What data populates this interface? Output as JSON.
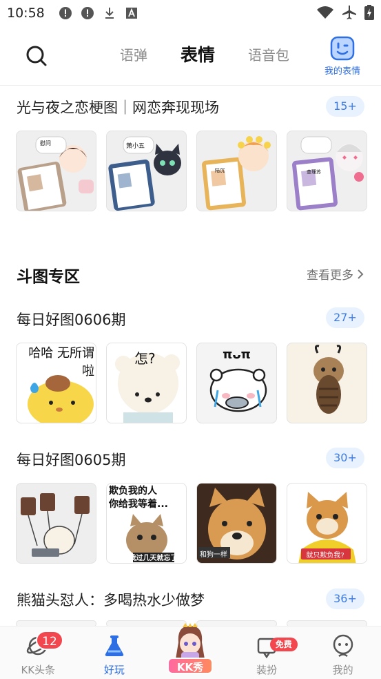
{
  "status_bar": {
    "time": "10:58",
    "left_icons": [
      "alert-circle-icon",
      "alert-circle-icon",
      "download-icon",
      "font-icon"
    ],
    "right_icons": [
      "wifi-icon",
      "airplane-icon",
      "battery-charging-icon"
    ]
  },
  "top_nav": {
    "tabs": [
      {
        "label": "语弹"
      },
      {
        "label": "表情"
      },
      {
        "label": "语音包"
      }
    ],
    "active_tab": "表情",
    "my_emoji_label": "我的表情"
  },
  "featured": {
    "title": "光与夜之恋梗图｜网恋奔现现场",
    "count": "15+",
    "thumbs": [
      {
        "caption": "慰问"
      },
      {
        "caption": "萧小五"
      },
      {
        "caption": "陆沉"
      },
      {
        "caption": "查理苏"
      }
    ]
  },
  "section": {
    "heading": "斗图专区",
    "see_more": "查看更多"
  },
  "rows": [
    {
      "title": "每日好图0606期",
      "count": "27+",
      "thumbs": [
        {
          "caption": "哈哈 无所谓\n啦"
        },
        {
          "caption": "怎?"
        },
        {
          "caption": "πᴗπ"
        },
        {
          "caption": ""
        }
      ]
    },
    {
      "title": "每日好图0605期",
      "count": "30+",
      "thumbs": [
        {
          "caption": ""
        },
        {
          "caption": "欺负我的人\n你给我等着...",
          "sub": "我过几天就忘了"
        },
        {
          "caption": "",
          "sub": "和狗一样"
        },
        {
          "caption": "",
          "sub": "就只欺负我?"
        }
      ]
    },
    {
      "title": "熊猫头怼人：多喝热水少做梦",
      "count": "36+"
    }
  ],
  "bottom_nav": {
    "items": [
      {
        "label": "KK头条",
        "badge": "12"
      },
      {
        "label": "好玩"
      },
      {
        "label": "KK秀"
      },
      {
        "label": "装扮",
        "badge": "免费"
      },
      {
        "label": "我的"
      }
    ],
    "active": "好玩"
  },
  "colors": {
    "accent": "#2f6fe4",
    "badge_bg": "#e8f2ff",
    "badge_text": "#3d7be0",
    "notif_red": "#f2474f",
    "tab_underline": "#ffd83a"
  }
}
